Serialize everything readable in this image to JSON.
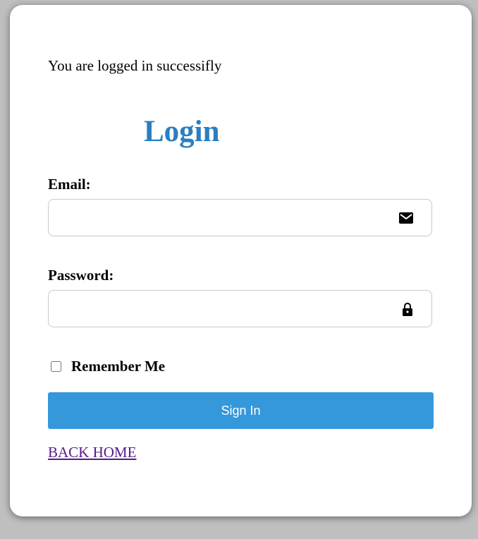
{
  "status_message": "You are logged in successifly",
  "form": {
    "title": "Login",
    "email": {
      "label": "Email:",
      "value": "",
      "icon": "envelope-icon"
    },
    "password": {
      "label": "Password:",
      "value": "",
      "icon": "lock-icon"
    },
    "remember": {
      "label": "Remember Me",
      "checked": false
    },
    "submit_label": "Sign In",
    "back_link": "BACK HOME"
  },
  "colors": {
    "title": "#2a7ec1",
    "button": "#3498db",
    "link_visited": "#551a8b",
    "backdrop": "#bfbfbf"
  }
}
